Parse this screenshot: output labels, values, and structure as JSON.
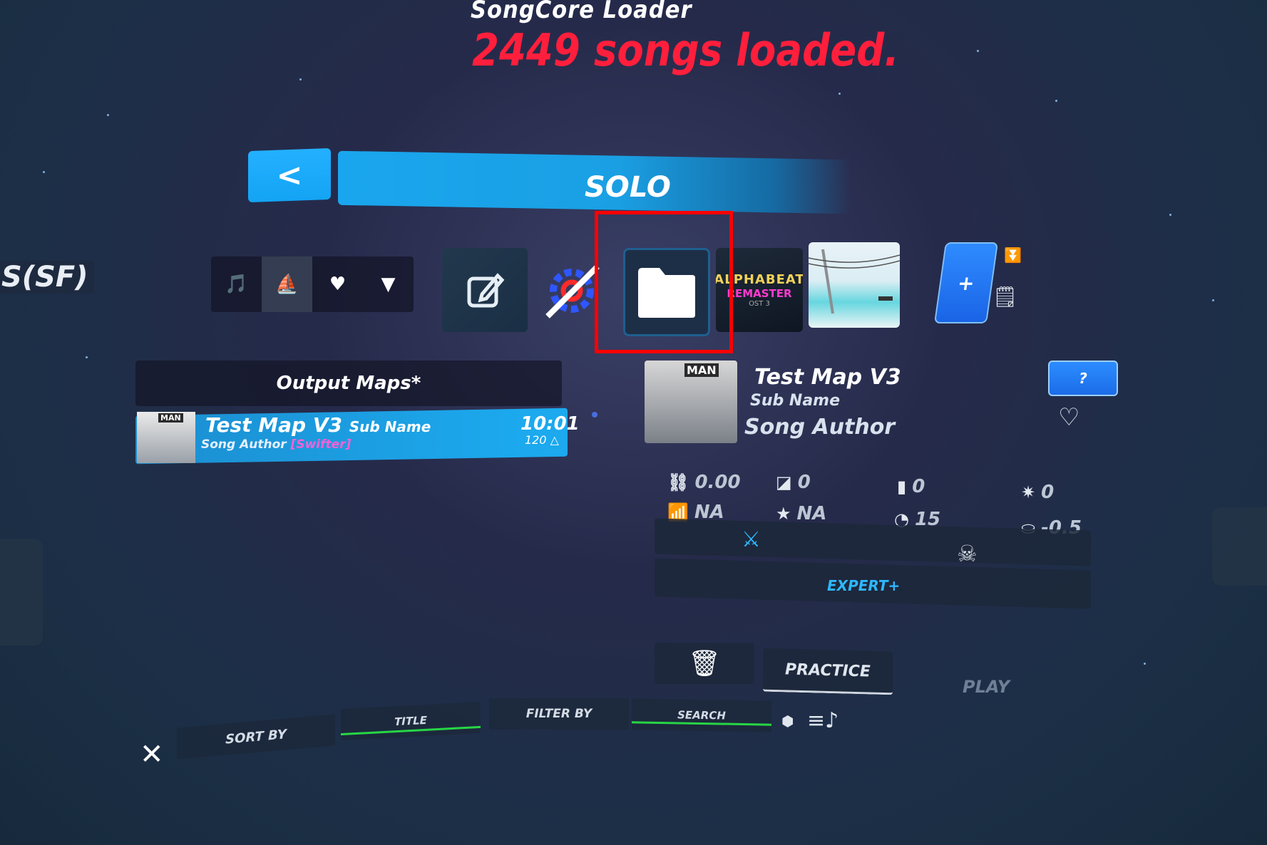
{
  "header": {
    "loader_title": "SongCore Loader",
    "loader_status": "2449 songs loaded."
  },
  "nav": {
    "back_icon": "chevron-left-icon",
    "back_glyph": "<",
    "title": "SOLO"
  },
  "side_label": "S(SF)",
  "tabs": [
    {
      "icon": "music-folder-icon",
      "glyph": "🎵"
    },
    {
      "icon": "level-pack-icon",
      "glyph": "⛵"
    },
    {
      "icon": "heart-icon",
      "glyph": "♥"
    },
    {
      "icon": "filter-icon",
      "glyph": "▼"
    }
  ],
  "playlists": {
    "alphabeat_line1": "ALPHABEAT",
    "alphabeat_line2": "REMASTER",
    "alphabeat_line3": "OST 3",
    "add_glyph": "+"
  },
  "song_list": {
    "header": "Output Maps*",
    "rows": [
      {
        "thumb_tag": "MAN",
        "title": "Test Map V3",
        "subtitle": "Sub Name",
        "author": "Song Author",
        "mapper": "[Swifter]",
        "duration": "10:01",
        "bpm": "120"
      }
    ]
  },
  "details": {
    "thumb_tag": "MAN",
    "title": "Test Map V3",
    "subtitle": "Sub Name",
    "author": "Song Author",
    "help_label": "?",
    "stats": {
      "nps": "0.00",
      "notes": "0",
      "bombs": "0",
      "lights": "0",
      "rank": "NA",
      "stars": "NA",
      "njs": "15",
      "offset": "-0.5"
    },
    "difficulty": "EXPERT+",
    "practice_label": "PRACTICE",
    "play_label": "PLAY"
  },
  "bottom_bar": {
    "sort_by": "SORT BY",
    "title": "TITLE",
    "filter_by": "FILTER BY",
    "search": "SEARCH"
  },
  "colors": {
    "accent_blue": "#1aa6ee",
    "status_red": "#ff1f3c",
    "mapper_pink": "#ff5fd6",
    "highlight_red": "#ff0000"
  }
}
